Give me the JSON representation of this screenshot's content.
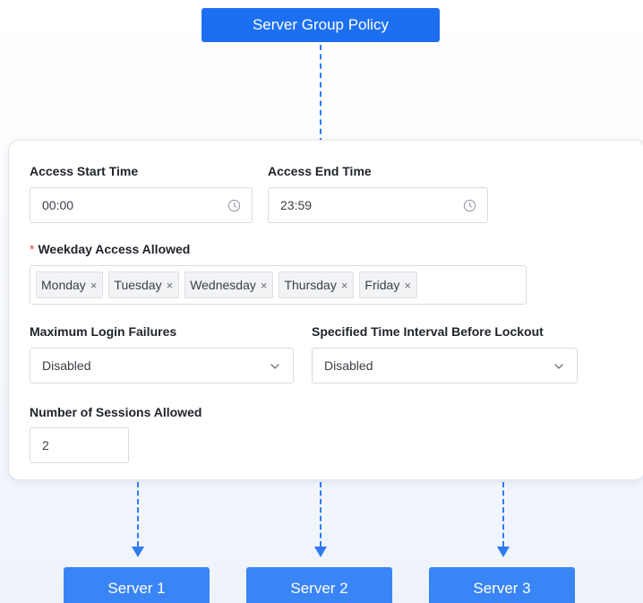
{
  "policy": {
    "title": "Server Group Policy"
  },
  "form": {
    "access_start": {
      "label": "Access Start Time",
      "value": "00:00"
    },
    "access_end": {
      "label": "Access End Time",
      "value": "23:59"
    },
    "weekday": {
      "required_mark": "*",
      "label": "Weekday Access Allowed",
      "tags": [
        "Monday",
        "Tuesday",
        "Wednesday",
        "Thursday",
        "Friday"
      ],
      "remove_glyph": "×"
    },
    "max_login_failures": {
      "label": "Maximum Login Failures",
      "value": "Disabled"
    },
    "lockout_interval": {
      "label": "Specified Time Interval Before Lockout",
      "value": "Disabled"
    },
    "sessions": {
      "label": "Number of Sessions Allowed",
      "value": "2"
    }
  },
  "servers": [
    "Server 1",
    "Server 2",
    "Server 3"
  ],
  "colors": {
    "accent": "#1d6ff2",
    "server": "#3a85f5",
    "connector": "#2f7bf0"
  }
}
